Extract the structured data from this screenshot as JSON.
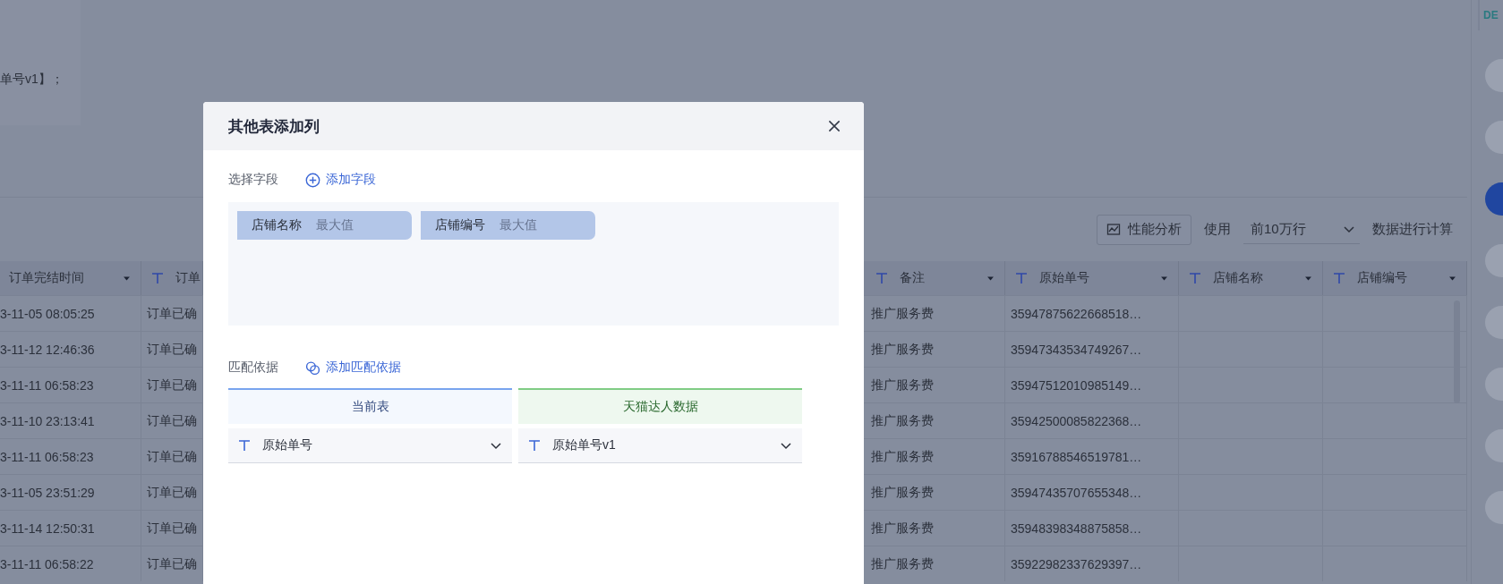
{
  "background": {
    "formula_text": "单号v1】；",
    "toolbar": {
      "analysis_button": "性能分析",
      "use_label": "使用",
      "row_limit": "前10万行",
      "suffix": "数据进行计算"
    },
    "table": {
      "columns": [
        {
          "label": "订单完结时间",
          "type_icon": false
        },
        {
          "label": "订单",
          "type_icon": true
        },
        {
          "label": "备注",
          "type_icon": true
        },
        {
          "label": "原始单号",
          "type_icon": true
        },
        {
          "label": "店铺名称",
          "type_icon": true
        },
        {
          "label": "店铺编号",
          "type_icon": true
        }
      ],
      "rows": [
        [
          "3-11-05 08:05:25",
          "订单已确",
          "推广服务费",
          "35947875622668518…"
        ],
        [
          "3-11-12 12:46:36",
          "订单已确",
          "推广服务费",
          "35947343534749267…"
        ],
        [
          "3-11-11 06:58:23",
          "订单已确",
          "推广服务费",
          "35947512010985149…"
        ],
        [
          "3-11-10 23:13:41",
          "订单已确",
          "推广服务费",
          "35942500085822368…"
        ],
        [
          "3-11-11 06:58:23",
          "订单已确",
          "推广服务费",
          "35916788546519781…"
        ],
        [
          "3-11-05 23:51:29",
          "订单已确",
          "推广服务费",
          "35947435707655348…"
        ],
        [
          "3-11-14 12:50:31",
          "订单已确",
          "推广服务费",
          "35948398348875858…"
        ],
        [
          "3-11-11 06:58:22",
          "订单已确",
          "推广服务费",
          "35922982337629397…"
        ]
      ]
    },
    "rail": {
      "top_label": "DE",
      "nodes": [
        {
          "selected": false
        },
        {
          "selected": false
        },
        {
          "selected": true
        },
        {
          "selected": false
        },
        {
          "selected": false
        },
        {
          "selected": false
        },
        {
          "selected": false
        },
        {
          "selected": false
        }
      ]
    }
  },
  "dialog": {
    "title": "其他表添加列",
    "fields_section": {
      "label": "选择字段",
      "add_link": "添加字段",
      "chips": [
        {
          "name": "店铺名称",
          "aggregate": "最大值"
        },
        {
          "name": "店铺编号",
          "aggregate": "最大值"
        }
      ]
    },
    "match_section": {
      "label": "匹配依据",
      "add_link": "添加匹配依据",
      "sides": [
        {
          "kind": "current",
          "header": "当前表",
          "field": "原始单号"
        },
        {
          "kind": "other",
          "header": "天猫达人数据",
          "field": "原始单号v1"
        }
      ]
    }
  }
}
